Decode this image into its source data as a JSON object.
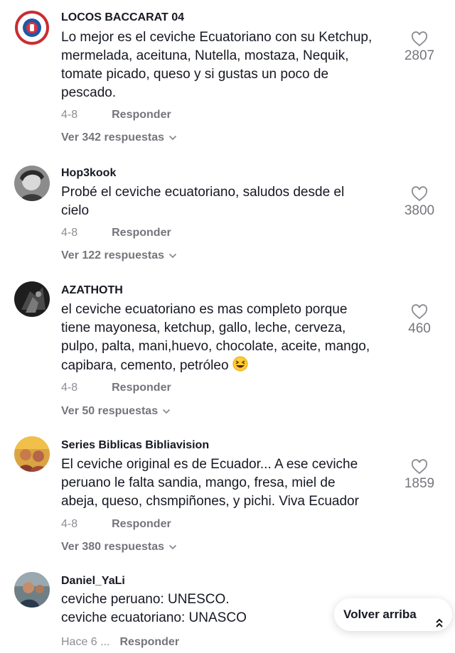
{
  "comments": [
    {
      "author": "LOCOS BACCARAT 04",
      "text": "Lo mejor es el ceviche Ecuatoriano con su Ketchup,\nmermelada, aceituna, Nutella, mostaza, Nequik,\ntomate picado, queso y si gustas un poco de\npescado.",
      "date": "4-8",
      "reply_label": "Responder",
      "view_replies": "Ver 342 respuestas",
      "likes": "2807"
    },
    {
      "author": "Hop3kook",
      "text": "Probé el ceviche ecuatoriano, saludos desde el\ncielo",
      "date": "4-8",
      "reply_label": "Responder",
      "view_replies": "Ver 122 respuestas",
      "likes": "3800"
    },
    {
      "author": "AZATHOTH",
      "text": "el ceviche ecuatoriano es mas completo porque\ntiene mayonesa, ketchup, gallo, leche, cerveza,\npulpo, palta, mani,huevo, chocolate, aceite, mango,\ncapibara, cemento, petróleo",
      "date": "4-8",
      "reply_label": "Responder",
      "view_replies": "Ver 50 respuestas",
      "likes": "460"
    },
    {
      "author": "Series Biblicas Bibliavision",
      "text": "El ceviche original es de Ecuador... A ese ceviche\nperuano le falta sandia, mango, fresa, miel de\nabeja, queso, chsmpiñones, y pichi. Viva Ecuador",
      "date": "4-8",
      "reply_label": "Responder",
      "view_replies": "Ver 380 respuestas",
      "likes": "1859"
    },
    {
      "author": "Daniel_YaLi",
      "text": "ceviche peruano: UNESCO.\nceviche ecuatoriano: UNASCO",
      "date": "Hace 6 ...",
      "reply_label": "Responder"
    }
  ],
  "back_to_top": "Volver arriba",
  "icons": {
    "like": "heart-outline-icon",
    "expand": "chevron-down-icon",
    "back_to_top": "double-chevron-up-icon",
    "emoji": "grinning-squinting-face-emoji"
  },
  "colors": {
    "text": "#161823",
    "muted": "#8a8b91",
    "background": "#ffffff"
  }
}
